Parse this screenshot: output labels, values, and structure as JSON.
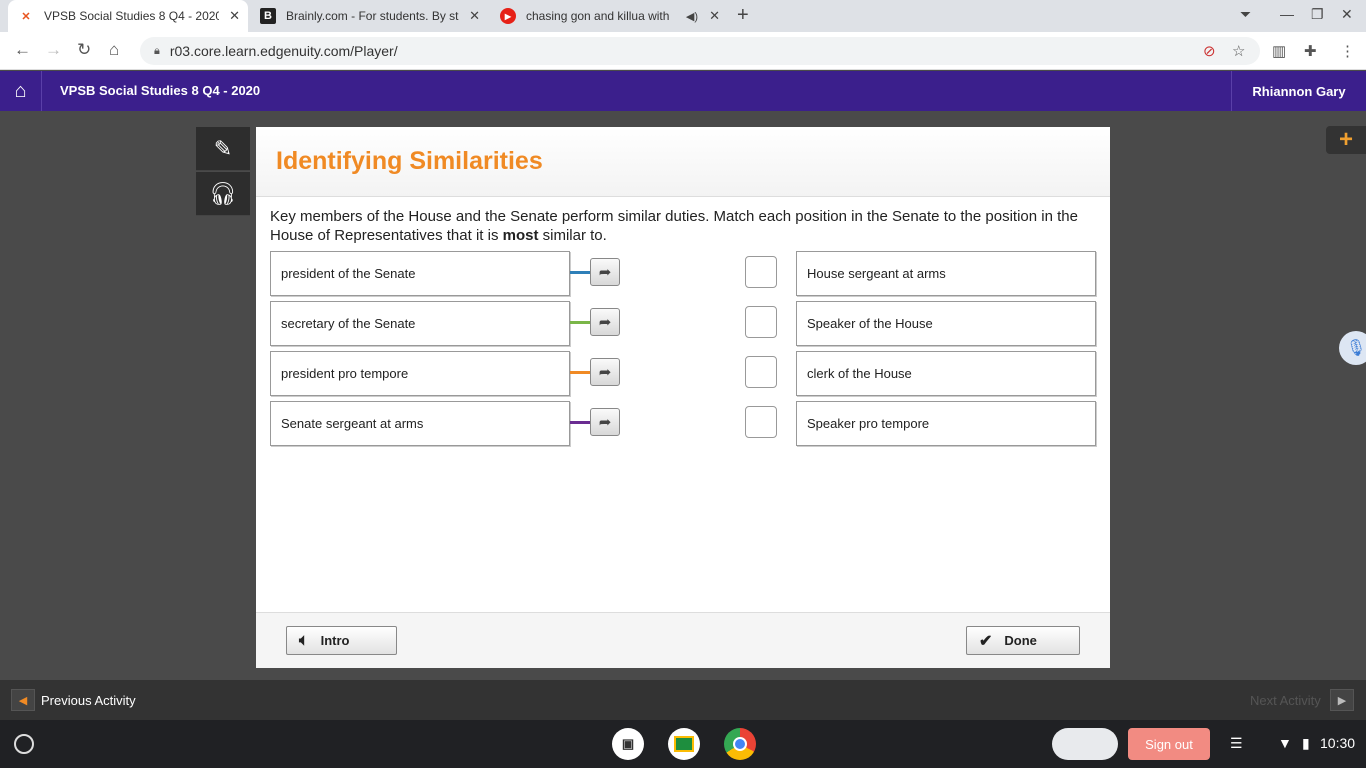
{
  "browser": {
    "tabs": [
      {
        "title": "VPSB Social Studies 8 Q4 - 2020",
        "favicon": "edgenuity-icon",
        "active": true
      },
      {
        "title": "Brainly.com - For students. By st",
        "favicon": "brainly-icon",
        "active": false
      },
      {
        "title": "chasing gon and killua with",
        "favicon": "youtube-icon",
        "active": false
      }
    ],
    "url": "r03.core.learn.edgenuity.com/Player/"
  },
  "app": {
    "course_title": "VPSB Social Studies 8 Q4 - 2020",
    "user_name": "Rhiannon Gary"
  },
  "activity": {
    "title": "Identifying Similarities",
    "prompt_before": "Key members of the House and the Senate perform similar duties. Match each position in the Senate to the position in the House of Representatives that it is ",
    "prompt_bold": "most",
    "prompt_after": " similar to.",
    "left_items": [
      {
        "label": "president of the Senate",
        "color": "#2e7fb8"
      },
      {
        "label": "secretary of the Senate",
        "color": "#7ab648"
      },
      {
        "label": "president pro tempore",
        "color": "#f08a24"
      },
      {
        "label": "Senate sergeant at arms",
        "color": "#6a2c91"
      }
    ],
    "right_items": [
      {
        "label": "House sergeant at arms"
      },
      {
        "label": "Speaker of the House"
      },
      {
        "label": "clerk of the House"
      },
      {
        "label": "Speaker pro tempore"
      }
    ],
    "intro_label": "Intro",
    "done_label": "Done"
  },
  "nav": {
    "previous_label": "Previous Activity",
    "next_label": "Next Activity"
  },
  "shelf": {
    "sign_out_label": "Sign out",
    "time": "10:30"
  },
  "colors": {
    "header_purple": "#3b1f8c",
    "title_orange": "#f08a24"
  }
}
